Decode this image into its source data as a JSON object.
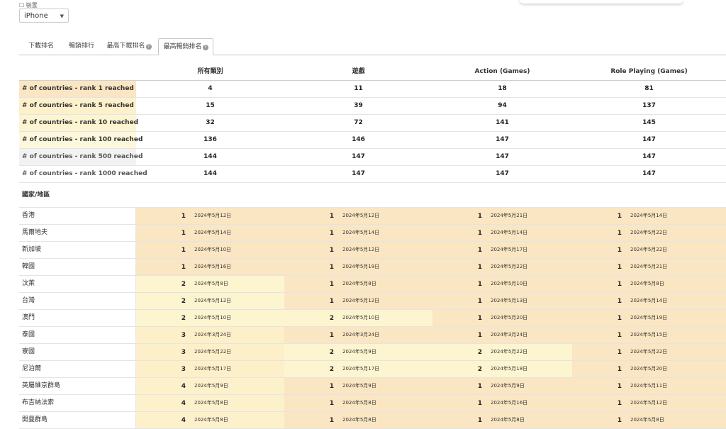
{
  "device": {
    "label": "☐ 裝置",
    "selected": "iPhone"
  },
  "tabs": [
    {
      "label": "下載排名",
      "help": false,
      "active": false
    },
    {
      "label": "暢銷排行",
      "help": false,
      "active": false
    },
    {
      "label": "最高下載排名",
      "help": true,
      "active": false
    },
    {
      "label": "最高暢銷排名",
      "help": true,
      "active": true
    }
  ],
  "columns": [
    "所有類別",
    "遊戲",
    "Action (Games)",
    "Role Playing (Games)"
  ],
  "summary": [
    {
      "label": "# of countries - rank 1 reached",
      "values": [
        "4",
        "11",
        "18",
        "81"
      ],
      "color": "#fae6c2"
    },
    {
      "label": "# of countries - rank 5 reached",
      "values": [
        "15",
        "39",
        "94",
        "137"
      ],
      "color": "#fdf1cc"
    },
    {
      "label": "# of countries - rank 10 reached",
      "values": [
        "32",
        "72",
        "141",
        "145"
      ],
      "color": "#fdf4d2"
    },
    {
      "label": "# of countries - rank 100 reached",
      "values": [
        "136",
        "146",
        "147",
        "147"
      ],
      "color": "#fdf8dc"
    },
    {
      "label": "# of countries - rank 500 reached",
      "values": [
        "144",
        "147",
        "147",
        "147"
      ],
      "color": "#f2f2f2"
    },
    {
      "label": "# of countries - rank 1000 reached",
      "values": [
        "144",
        "147",
        "147",
        "147"
      ],
      "color": "#ffffff"
    }
  ],
  "region_header": "國家/地區",
  "countries": [
    {
      "name": "香港",
      "cells": [
        {
          "rank": "1",
          "date": "2024年5月12日"
        },
        {
          "rank": "1",
          "date": "2024年5月12日"
        },
        {
          "rank": "1",
          "date": "2024年5月21日"
        },
        {
          "rank": "1",
          "date": "2024年5月14日"
        }
      ]
    },
    {
      "name": "馬爾地夫",
      "cells": [
        {
          "rank": "1",
          "date": "2024年5月14日"
        },
        {
          "rank": "1",
          "date": "2024年5月14日"
        },
        {
          "rank": "1",
          "date": "2024年5月14日"
        },
        {
          "rank": "1",
          "date": "2024年5月22日"
        }
      ]
    },
    {
      "name": "新加坡",
      "cells": [
        {
          "rank": "1",
          "date": "2024年5月10日"
        },
        {
          "rank": "1",
          "date": "2024年5月12日"
        },
        {
          "rank": "1",
          "date": "2024年5月17日"
        },
        {
          "rank": "1",
          "date": "2024年5月22日"
        }
      ]
    },
    {
      "name": "韓國",
      "cells": [
        {
          "rank": "1",
          "date": "2024年5月16日"
        },
        {
          "rank": "1",
          "date": "2024年5月19日"
        },
        {
          "rank": "1",
          "date": "2024年5月22日"
        },
        {
          "rank": "1",
          "date": "2024年5月21日"
        }
      ]
    },
    {
      "name": "汶萊",
      "cells": [
        {
          "rank": "2",
          "date": "2024年5月8日"
        },
        {
          "rank": "1",
          "date": "2024年5月8日"
        },
        {
          "rank": "1",
          "date": "2024年5月10日"
        },
        {
          "rank": "1",
          "date": "2024年5月8日"
        }
      ]
    },
    {
      "name": "台灣",
      "cells": [
        {
          "rank": "2",
          "date": "2024年5月12日"
        },
        {
          "rank": "1",
          "date": "2024年5月12日"
        },
        {
          "rank": "1",
          "date": "2024年5月13日"
        },
        {
          "rank": "1",
          "date": "2024年5月14日"
        }
      ]
    },
    {
      "name": "澳門",
      "cells": [
        {
          "rank": "2",
          "date": "2024年5月10日"
        },
        {
          "rank": "2",
          "date": "2024年5月10日"
        },
        {
          "rank": "1",
          "date": "2024年5月20日"
        },
        {
          "rank": "1",
          "date": "2024年5月19日"
        }
      ]
    },
    {
      "name": "泰國",
      "cells": [
        {
          "rank": "3",
          "date": "2024年3月24日"
        },
        {
          "rank": "1",
          "date": "2024年3月24日"
        },
        {
          "rank": "1",
          "date": "2024年3月24日"
        },
        {
          "rank": "1",
          "date": "2024年5月15日"
        }
      ]
    },
    {
      "name": "寮國",
      "cells": [
        {
          "rank": "3",
          "date": "2024年5月22日"
        },
        {
          "rank": "2",
          "date": "2024年5月9日"
        },
        {
          "rank": "2",
          "date": "2024年5月22日"
        },
        {
          "rank": "1",
          "date": "2024年5月22日"
        }
      ]
    },
    {
      "name": "尼泊爾",
      "cells": [
        {
          "rank": "3",
          "date": "2024年5月17日"
        },
        {
          "rank": "2",
          "date": "2024年5月17日"
        },
        {
          "rank": "2",
          "date": "2024年5月18日"
        },
        {
          "rank": "1",
          "date": "2024年5月20日"
        }
      ]
    },
    {
      "name": "英屬維京群島",
      "cells": [
        {
          "rank": "4",
          "date": "2024年5月9日"
        },
        {
          "rank": "1",
          "date": "2024年5月9日"
        },
        {
          "rank": "1",
          "date": "2024年5月9日"
        },
        {
          "rank": "1",
          "date": "2024年5月11日"
        }
      ]
    },
    {
      "name": "布吉納法索",
      "cells": [
        {
          "rank": "4",
          "date": "2024年5月8日"
        },
        {
          "rank": "1",
          "date": "2024年5月8日"
        },
        {
          "rank": "1",
          "date": "2024年5月16日"
        },
        {
          "rank": "1",
          "date": "2024年5月12日"
        }
      ]
    },
    {
      "name": "開曼群島",
      "cells": [
        {
          "rank": "4",
          "date": "2024年5月8日"
        },
        {
          "rank": "1",
          "date": "2024年5月8日"
        },
        {
          "rank": "1",
          "date": "2024年5月8日"
        },
        {
          "rank": "1",
          "date": "2024年5月8日"
        }
      ]
    }
  ],
  "rank_colors": {
    "1": "#fae6c2",
    "2": "#fdf5d0",
    "3": "#fdf0c8",
    "4": "#fdf1cc"
  }
}
